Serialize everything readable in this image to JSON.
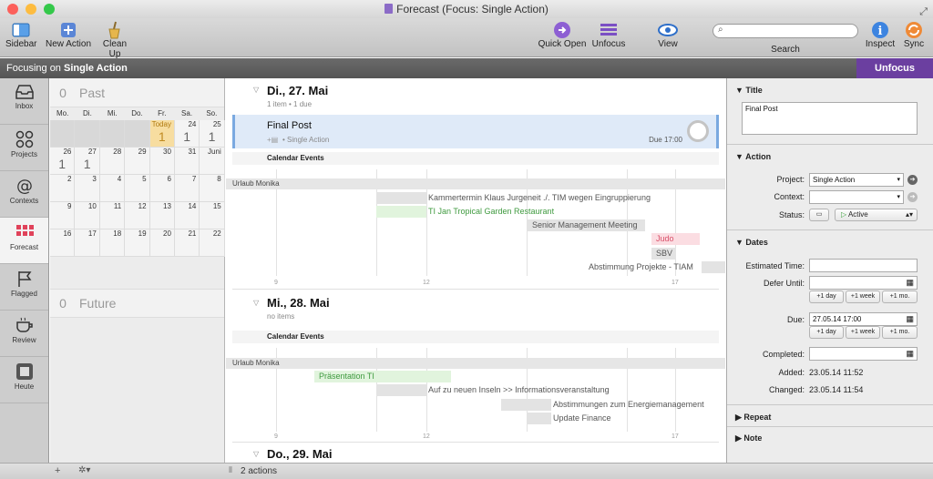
{
  "window": {
    "title": "Forecast (Focus: Single Action)"
  },
  "toolbar": {
    "sidebar": "Sidebar",
    "new_action": "New Action",
    "clean_up": "Clean Up",
    "quick_open": "Quick Open",
    "unfocus": "Unfocus",
    "view": "View",
    "search": "Search",
    "inspect": "Inspect",
    "sync": "Sync",
    "search_placeholder": ""
  },
  "focus": {
    "prefix": "Focusing on",
    "project": "Single Action",
    "unfocus_button": "Unfocus"
  },
  "sidebar": {
    "items": [
      {
        "label": "Inbox",
        "icon": "inbox-icon"
      },
      {
        "label": "Projects",
        "icon": "projects-icon"
      },
      {
        "label": "Contexts",
        "icon": "at-sign-icon"
      },
      {
        "label": "Forecast",
        "icon": "forecast-grid-icon"
      },
      {
        "label": "Flagged",
        "icon": "flag-icon"
      },
      {
        "label": "Review",
        "icon": "coffee-cup-icon"
      },
      {
        "label": "Heute",
        "icon": "heute-icon"
      }
    ]
  },
  "calendar": {
    "past": {
      "count": "0",
      "label": "Past"
    },
    "future": {
      "count": "0",
      "label": "Future"
    },
    "dows": [
      "Mo.",
      "Di.",
      "Mi.",
      "Do.",
      "Fr.",
      "Sa.",
      "So."
    ],
    "row1": [
      {
        "d": "",
        "n": "",
        "s": "dark"
      },
      {
        "d": "",
        "n": "",
        "s": "dark"
      },
      {
        "d": "",
        "n": "",
        "s": "dark"
      },
      {
        "d": "",
        "n": "",
        "s": "dark"
      },
      {
        "d": "Today",
        "n": "1",
        "s": "today"
      },
      {
        "d": "24",
        "n": "1",
        "s": ""
      },
      {
        "d": "25",
        "n": "1",
        "s": ""
      }
    ],
    "row2": [
      {
        "d": "26",
        "n": "1",
        "s": ""
      },
      {
        "d": "27",
        "n": "1",
        "s": ""
      },
      {
        "d": "28",
        "n": "",
        "s": ""
      },
      {
        "d": "29",
        "n": "",
        "s": ""
      },
      {
        "d": "30",
        "n": "",
        "s": ""
      },
      {
        "d": "31",
        "n": "",
        "s": ""
      },
      {
        "d": "Juni",
        "n": "",
        "s": ""
      }
    ],
    "row3": [
      "2",
      "3",
      "4",
      "5",
      "6",
      "7",
      "8"
    ],
    "row4": [
      "9",
      "10",
      "11",
      "12",
      "13",
      "14",
      "15"
    ],
    "row5": [
      "16",
      "17",
      "18",
      "19",
      "20",
      "21",
      "22"
    ]
  },
  "main": {
    "day1": {
      "title": "Di., 27. Mai",
      "sub": "1 item • 1 due"
    },
    "task": {
      "title": "Final Post",
      "meta": "• Single Action",
      "due": "Due 17:00"
    },
    "calendar_events": "Calendar Events",
    "urlaub": "Urlaub Monika",
    "events1": [
      {
        "text": "Kammertermin Klaus Jurgeneit ./. TIM wegen Eingruppierung",
        "color": "#555555"
      },
      {
        "text": "TI Jan Tropical Garden Restaurant",
        "color": "#3f9a3f"
      },
      {
        "text": "Senior Management Meeting",
        "color": "#555555"
      },
      {
        "text": "Judo",
        "color": "#d9506a"
      },
      {
        "text": "SBV",
        "color": "#555555"
      },
      {
        "text": "Abstimmung Projekte - TIAM",
        "color": "#555555"
      }
    ],
    "axis": [
      "9",
      "12",
      "17"
    ],
    "day2": {
      "title": "Mi., 28. Mai",
      "sub": "no items"
    },
    "events2": [
      {
        "text": "Präsentation TI",
        "color": "#3f9a3f"
      },
      {
        "text": "Auf zu neuen Inseln >> Informationsveranstaltung",
        "color": "#555555"
      },
      {
        "text": "Abstimmungen zum Energiemanagement",
        "color": "#555555"
      },
      {
        "text": "Update Finance",
        "color": "#555555"
      }
    ],
    "day3": {
      "title": "Do., 29. Mai"
    }
  },
  "status": {
    "actions": "2 actions"
  },
  "inspector": {
    "title_section": "Title",
    "title_value": "Final Post",
    "action_section": "Action",
    "project_label": "Project:",
    "project_value": "Single Action",
    "context_label": "Context:",
    "context_value": "",
    "status_label": "Status:",
    "status_value": "Active",
    "dates_section": "Dates",
    "estimated_label": "Estimated Time:",
    "estimated_value": "",
    "defer_label": "Defer Until:",
    "defer_value": "",
    "due_label": "Due:",
    "due_value": "27.05.14 17:00",
    "completed_label": "Completed:",
    "completed_value": "",
    "plus_day": "+1 day",
    "plus_week": "+1 week",
    "plus_month": "+1 mo.",
    "added_label": "Added:",
    "added_value": "23.05.14 11:52",
    "changed_label": "Changed:",
    "changed_value": "23.05.14 11:54",
    "repeat_section": "Repeat",
    "note_section": "Note"
  }
}
